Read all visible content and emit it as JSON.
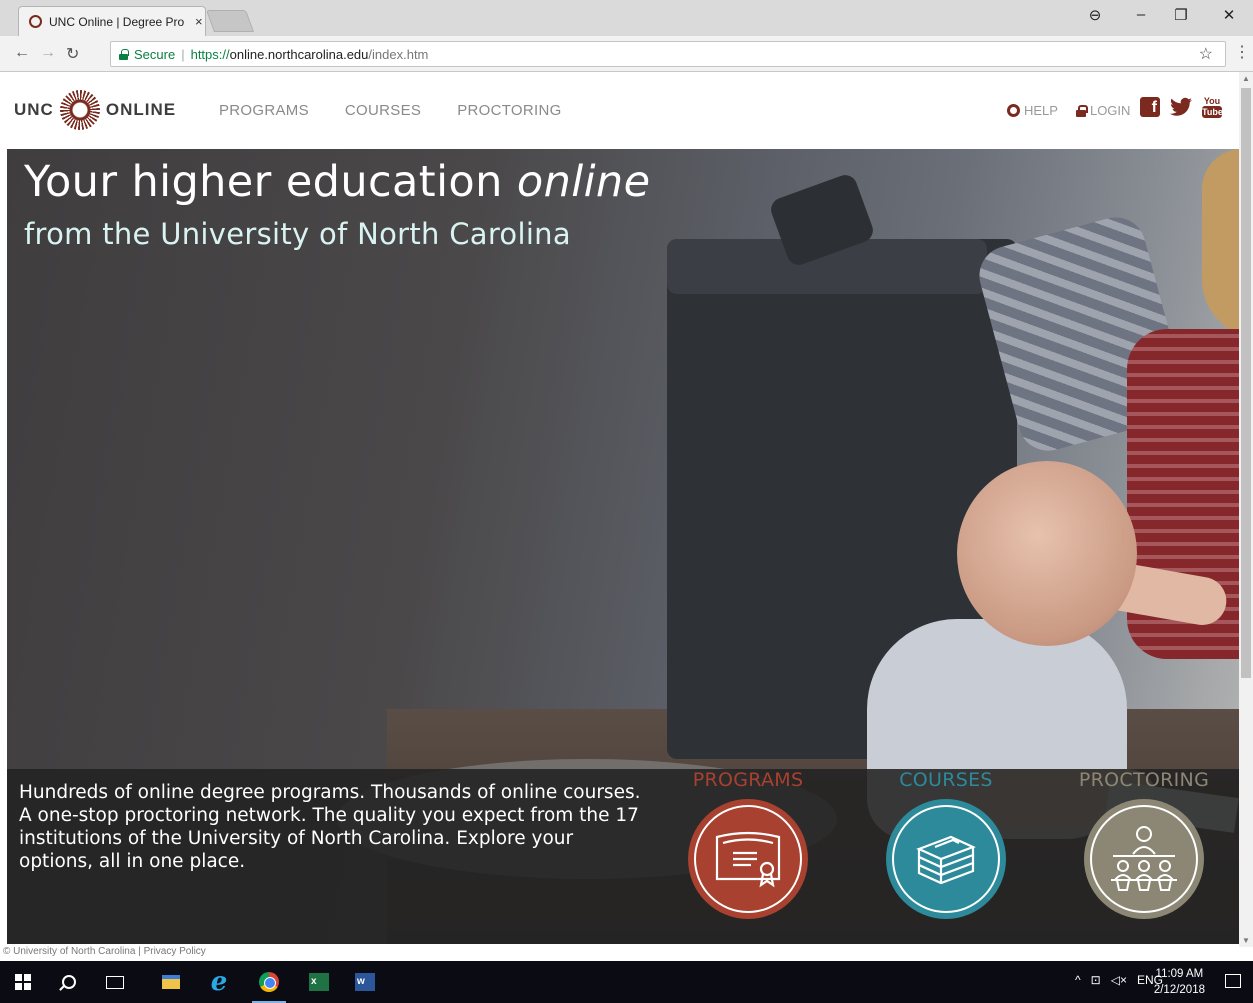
{
  "browser": {
    "tab_title": "UNC Online | Degree Pro",
    "tab_close": "×",
    "secure_label": "Secure",
    "url_scheme": "https://",
    "url_host": "online.northcarolina.edu",
    "url_path": "/index.htm"
  },
  "site": {
    "logo_left": "UNC",
    "logo_right": "ONLINE",
    "nav": [
      "PROGRAMS",
      "COURSES",
      "PROCTORING"
    ],
    "help": "HELP",
    "login": "LOGIN",
    "social": {
      "facebook": "f",
      "twitter": "🐦",
      "youtube_top": "You",
      "youtube_bottom": "Tube"
    }
  },
  "hero": {
    "title_main": "Your higher education ",
    "title_em": "online",
    "subtitle": "from the University of North Carolina",
    "blurb": "Hundreds of online degree programs. Thousands of online courses. A one-stop proctoring network. The quality you expect from the 17 institutions of the University of North Carolina. Explore your options, all in one place.",
    "cards": [
      {
        "label": "PROGRAMS",
        "color": "#a8412f",
        "icon": "diploma-icon"
      },
      {
        "label": "COURSES",
        "color": "#2d8a9a",
        "icon": "books-icon"
      },
      {
        "label": "PROCTORING",
        "color": "#8c8775",
        "icon": "classroom-icon"
      }
    ]
  },
  "footer": {
    "text": "© University of North Carolina | Privacy Policy"
  },
  "taskbar": {
    "tray_lang": "ENG",
    "time": "11:09 AM",
    "date": "2/12/2018"
  },
  "colors": {
    "brand": "#7a2a1e",
    "programs": "#a8412f",
    "courses": "#2d8a9a",
    "proctoring": "#8c8775"
  }
}
